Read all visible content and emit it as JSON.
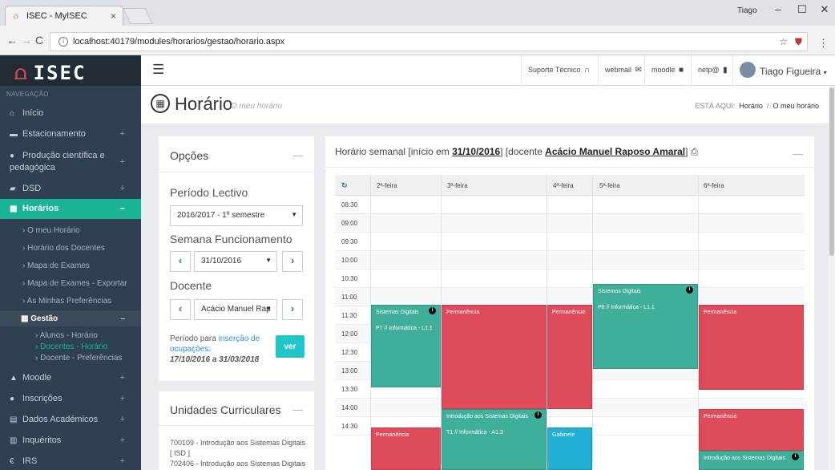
{
  "browser": {
    "tab_title": "ISEC - MyISEC",
    "tab_close": "×",
    "favicon": "ISEC",
    "win_user": "Tiago",
    "url": "localhost:40179/modules/horarios/gestao/horario.aspx",
    "icons": [
      "back-icon",
      "forward-icon",
      "reload-icon",
      "info-icon",
      "star-icon",
      "shield-icon",
      "menu-icon"
    ]
  },
  "brand": {
    "logo_text": "ISEC"
  },
  "topbar": {
    "links": [
      "Suporte Técnico",
      "webmail",
      "moodle",
      "netp@"
    ],
    "user": "Tiago Figueira"
  },
  "sidebar": {
    "heading": "NAVEGAÇÃO",
    "items": [
      {
        "label": "Início",
        "icon": "home-icon"
      },
      {
        "label": "Estacionamento",
        "icon": "car-icon"
      },
      {
        "label": "Produção científica e pedagógica",
        "icon": "user-icon"
      },
      {
        "label": "DSD",
        "icon": "book-icon"
      },
      {
        "label": "Horários",
        "icon": "calendar-icon"
      },
      {
        "label": "Moodle",
        "icon": "graduation-icon"
      },
      {
        "label": "Inscrições",
        "icon": "user-icon"
      },
      {
        "label": "Dados Académicos",
        "icon": "table-icon"
      },
      {
        "label": "Inquéritos",
        "icon": "chart-icon"
      },
      {
        "label": "IRS",
        "icon": "euro-icon"
      }
    ],
    "horarios_sub": [
      "O meu Horário",
      "Horário dos Docentes",
      "Mapa de Exames",
      "Mapa de Exames - Exportar",
      "As Minhas Preferências"
    ],
    "gestao": "Gestão",
    "gestao_sub": [
      "Alunos - Horário",
      "Docentes - Horário",
      "Docente - Preferências"
    ]
  },
  "page": {
    "title": "Horário",
    "subtitle": "O meu horário",
    "crumb_prefix": "ESTÁ AQUI:",
    "crumb_1": "Horário",
    "crumb_sep": "/",
    "crumb_2": "O meu horário"
  },
  "options": {
    "title": "Opções",
    "collapse": "—",
    "periodo_label": "Período Lectivo",
    "periodo_value": "2016/2017 - 1º semestre",
    "semana_label": "Semana Funcionamento",
    "semana_value": "31/10/2016",
    "docente_label": "Docente",
    "docente_value": "Acácio Manuel Rap",
    "periodo_text_1": "Período para ",
    "periodo_text_link": "inserção de ocupações:",
    "periodo_dates": "17/10/2016 a 31/03/2018",
    "ver_button": "ver"
  },
  "ucs": {
    "title": "Unidades Curriculares",
    "collapse": "—",
    "items": [
      "700109 - Introdução aos Sistemas Digitais [ ISD ]",
      "702406 - Introdução aos Sistemas Digitais ["
    ]
  },
  "timetable": {
    "title_prefix": "Horário semanal [início em ",
    "start_date": "31/10/2016",
    "title_mid": "]  [docente ",
    "teacher": "Acácio Manuel Raposo Amaral",
    "title_suffix": "]",
    "collapse": "—",
    "days": [
      "2ª-feira",
      "3ª-feira",
      "4ª-feira",
      "5ª-feira",
      "6ª-feira"
    ],
    "times": [
      "08:30",
      "09:00",
      "09:30",
      "10:00",
      "10:30",
      "11:00",
      "11:30",
      "12:00",
      "12:30",
      "13:00",
      "13:30",
      "14:00",
      "14:30"
    ],
    "blocks": [
      {
        "title": "Sistemas Digitais",
        "detail": "P8 // Informática - L1.1",
        "info": "i",
        "color": "green"
      },
      {
        "title": "Sistemas Digitais",
        "detail": "P7 // Informática - L1.1",
        "info": "i",
        "color": "green"
      },
      {
        "title": "Permanência",
        "detail": "",
        "color": "red"
      },
      {
        "title": "Permanência",
        "detail": "",
        "color": "red"
      },
      {
        "title": "Permanência",
        "detail": "",
        "color": "red"
      },
      {
        "title": "Introdução aos Sistemas Digitais",
        "detail": "T1 // Informática - A1.3",
        "info": "i",
        "color": "green"
      },
      {
        "title": "Permanência",
        "detail": "",
        "color": "red"
      },
      {
        "title": "Permanência",
        "detail": "",
        "color": "red"
      },
      {
        "title": "Gabinete",
        "detail": "",
        "color": "blue"
      },
      {
        "title": "Introdução aos Sistemas Digitais",
        "detail": "",
        "info": "i",
        "color": "green"
      }
    ]
  },
  "colors": {
    "accent": "#1ab394",
    "sidebar": "#2f4050",
    "green_block": "#3fae9a",
    "red_block": "#de4b5a",
    "blue_block": "#21b0d4"
  }
}
